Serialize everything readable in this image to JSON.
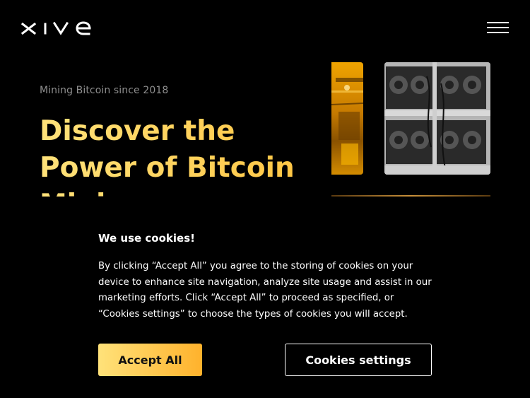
{
  "header": {
    "logo_text": "XIVE",
    "menu_icon": "hamburger-menu-icon"
  },
  "hero": {
    "subtitle": "Mining Bitcoin since 2018",
    "title": "Discover the Power of Bitcoin Mining"
  },
  "cookie_banner": {
    "title": "We use cookies!",
    "text": "By clicking “Accept All” you agree to the storing of cookies on your device to enhance site navigation, analyze site usage and assist in our marketing efforts. Click “Accept All” to proceed as specified, or “Cookies settings” to choose the types of cookies you will accept.",
    "accept_label": "Accept All",
    "settings_label": "Cookies settings"
  },
  "colors": {
    "background": "#000000",
    "accent_start": "#ffe27a",
    "accent_end": "#ffb22c",
    "subtitle": "#8e8e8e"
  }
}
